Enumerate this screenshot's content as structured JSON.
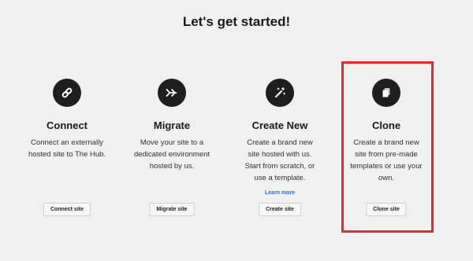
{
  "page": {
    "title": "Let's get started!"
  },
  "cards": [
    {
      "id": "connect",
      "icon": "link-icon",
      "title": "Connect",
      "description": "Connect an externally hosted site to The Hub.",
      "button": "Connect site"
    },
    {
      "id": "migrate",
      "icon": "migrate-arrows-icon",
      "title": "Migrate",
      "description": "Move your site to a dedicated environment hosted by us.",
      "button": "Migrate site"
    },
    {
      "id": "create",
      "icon": "magic-wand-icon",
      "title": "Create New",
      "description": "Create a brand new site hosted with us. Start from scratch, or use a template.",
      "link": "Learn more",
      "button": "Create site"
    },
    {
      "id": "clone",
      "icon": "copy-pages-icon",
      "title": "Clone",
      "description": "Create a brand new site from pre-made templates or use your own.",
      "button": "Clone site"
    }
  ],
  "colors": {
    "background": "#f0f0f0",
    "icon_circle": "#1e1e1e",
    "link": "#2f6fd6",
    "highlight": "#e8292c"
  }
}
